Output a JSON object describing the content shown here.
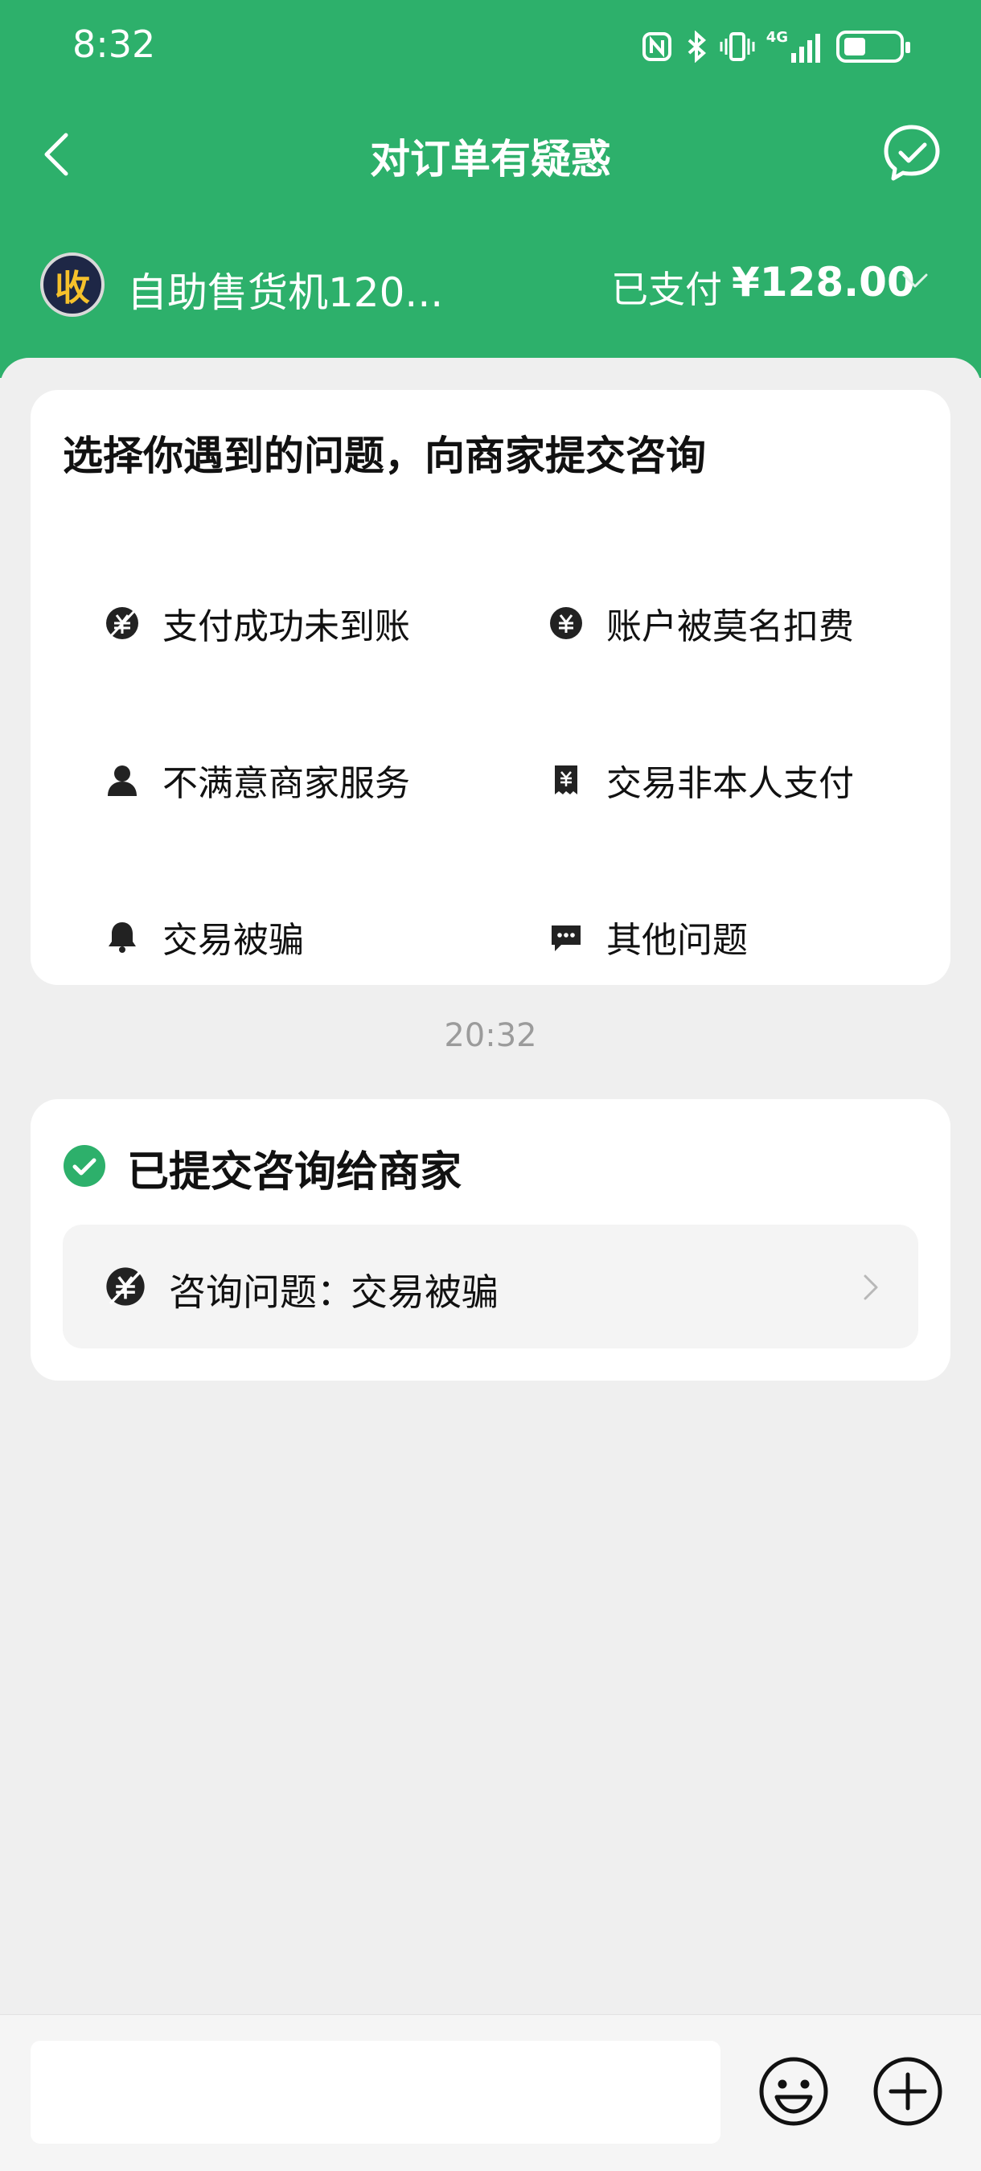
{
  "status_bar": {
    "time": "8:32",
    "icons": [
      "nfc-icon",
      "bluetooth-icon",
      "vibrate-icon",
      "signal-4g-icon",
      "battery-icon"
    ],
    "network_label": "4G"
  },
  "header": {
    "title": "对订单有疑惑",
    "back_icon": "chevron-left-icon",
    "chat_icon": "chat-check-icon"
  },
  "merchant": {
    "avatar_text": "收",
    "name": "自助售货机120...",
    "status": "已支付",
    "amount": "¥128.00"
  },
  "issues": {
    "title": "选择你遇到的问题，向商家提交咨询",
    "items": [
      {
        "label": "支付成功未到账",
        "icon": "payment-missing-icon"
      },
      {
        "label": "账户被莫名扣费",
        "icon": "yen-coin-icon"
      },
      {
        "label": "不满意商家服务",
        "icon": "person-icon"
      },
      {
        "label": "交易非本人支付",
        "icon": "receipt-icon"
      },
      {
        "label": "交易被骗",
        "icon": "bell-icon"
      },
      {
        "label": "其他问题",
        "icon": "message-dots-icon"
      }
    ]
  },
  "timestamp": "20:32",
  "submitted": {
    "title": "已提交咨询给商家",
    "consult_label": "咨询问题：",
    "consult_value": "交易被骗"
  },
  "input": {
    "placeholder": ""
  },
  "colors": {
    "brand_green": "#2db06b",
    "background": "#efefef",
    "avatar_bg": "#1e2746",
    "avatar_fg": "#f6c12b"
  }
}
